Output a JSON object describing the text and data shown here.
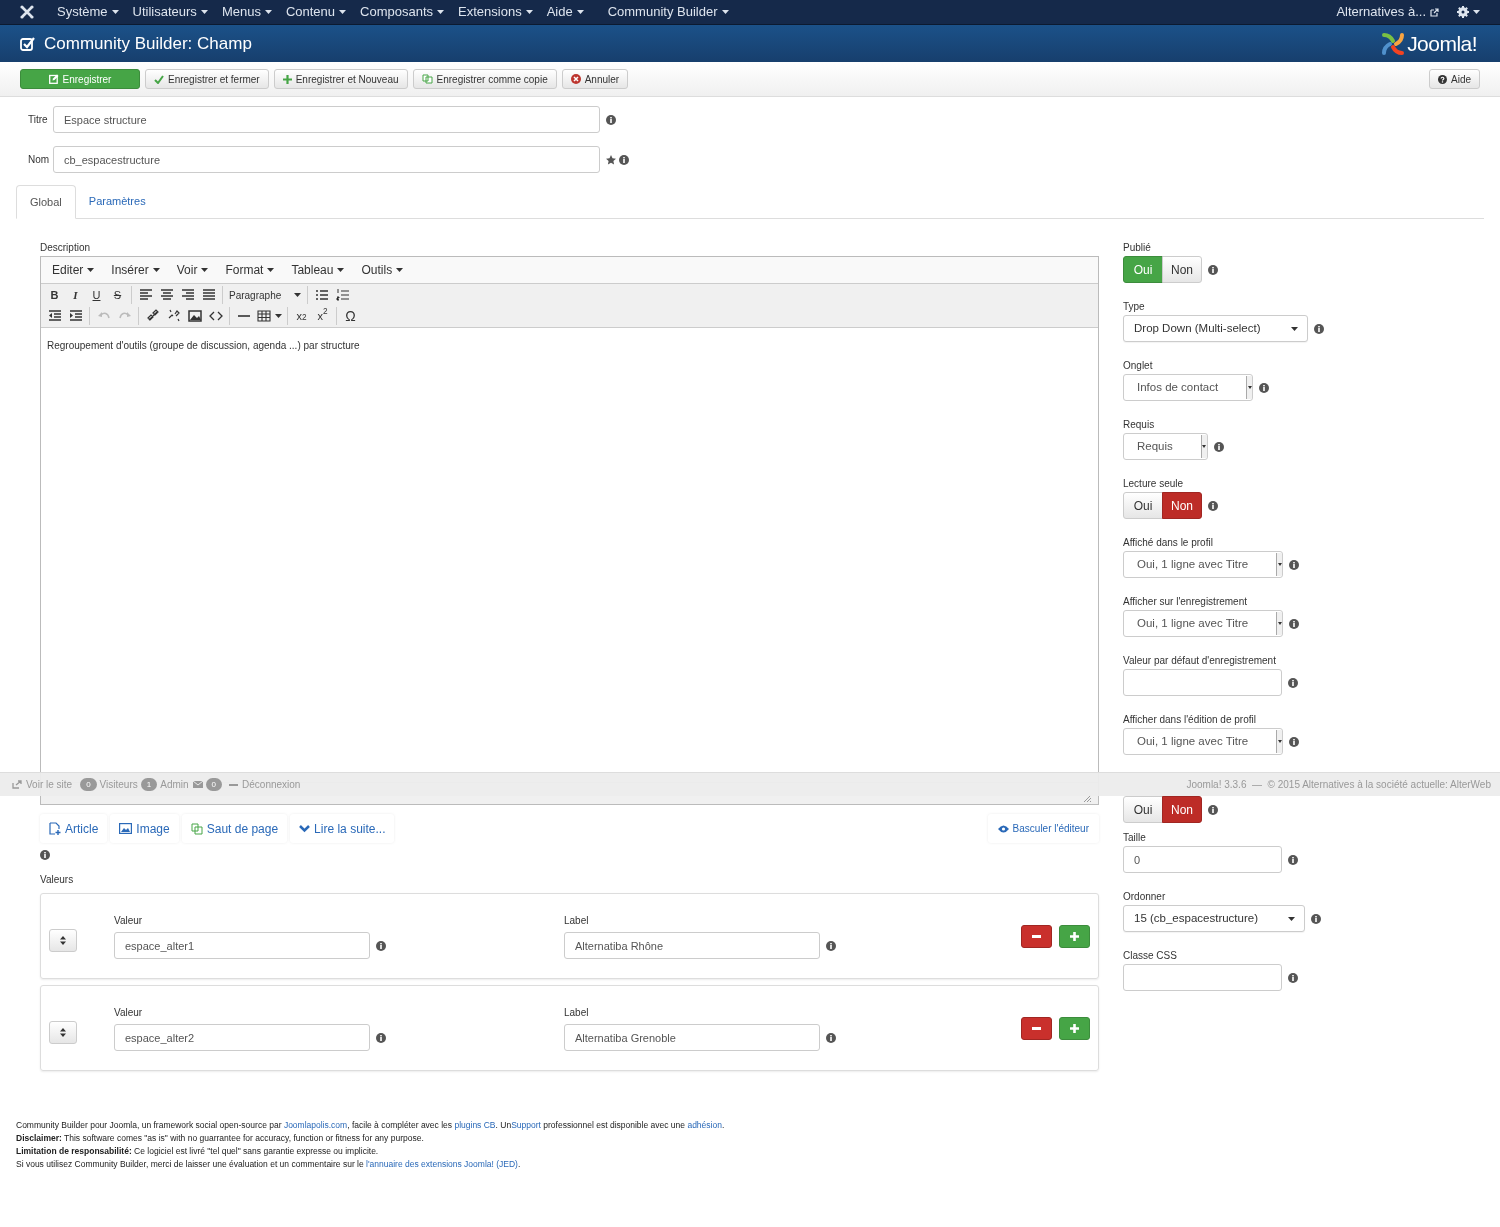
{
  "topbar": {
    "menus": [
      "Système",
      "Utilisateurs",
      "Menus",
      "Contenu",
      "Composants",
      "Extensions",
      "Aide",
      "Community Builder"
    ],
    "site_link": "Alternatives à..."
  },
  "header": {
    "title": "Community Builder: Champ",
    "logo": "Joomla!"
  },
  "toolbar": {
    "buttons": [
      {
        "kind": "save",
        "label": "Enregistrer"
      },
      {
        "kind": "check",
        "label": "Enregistrer et fermer"
      },
      {
        "kind": "plus",
        "label": "Enregistrer et Nouveau"
      },
      {
        "kind": "copy",
        "label": "Enregistrer comme copie"
      },
      {
        "kind": "cancel",
        "label": "Annuler"
      }
    ],
    "help": "Aide"
  },
  "fields": [
    {
      "label": "Titre",
      "value": "Espace structure",
      "required": false
    },
    {
      "label": "Nom",
      "value": "cb_espacestructure",
      "required": true
    }
  ],
  "tabs": [
    {
      "label": "Global",
      "selected": true
    },
    {
      "label": "Paramètres",
      "selected": false
    }
  ],
  "editor": {
    "label": "Description",
    "menus": [
      "Editer",
      "Insérer",
      "Voir",
      "Format",
      "Tableau",
      "Outils"
    ],
    "toolbar_rows": [
      [
        {
          "kind": "text",
          "label": "B",
          "disabled": false
        },
        {
          "kind": "text",
          "label": "I",
          "disabled": false
        },
        {
          "kind": "text",
          "label": "U",
          "disabled": false
        },
        {
          "kind": "text",
          "label": "S",
          "disabled": false
        },
        {
          "kind": "sep"
        },
        {
          "kind": "icon",
          "disabled": false
        },
        {
          "kind": "icon",
          "disabled": false
        },
        {
          "kind": "icon",
          "disabled": false
        },
        {
          "kind": "icon",
          "disabled": false
        },
        {
          "kind": "sep"
        },
        {
          "kind": "dropdown",
          "label": "Paragraphe",
          "disabled": false
        },
        {
          "kind": "sep"
        },
        {
          "kind": "icon",
          "disabled": false
        },
        {
          "kind": "icon",
          "disabled": false
        }
      ],
      [
        {
          "kind": "icon",
          "disabled": false
        },
        {
          "kind": "icon",
          "disabled": false
        },
        {
          "kind": "sep"
        },
        {
          "kind": "icon",
          "disabled": true
        },
        {
          "kind": "icon",
          "disabled": true
        },
        {
          "kind": "sep"
        },
        {
          "kind": "icon",
          "disabled": false
        },
        {
          "kind": "icon",
          "disabled": false
        },
        {
          "kind": "icon",
          "disabled": false
        },
        {
          "kind": "icon",
          "disabled": false
        },
        {
          "kind": "sep"
        },
        {
          "kind": "icon",
          "disabled": false
        },
        {
          "kind": "table",
          "disabled": false
        },
        {
          "kind": "sep"
        },
        {
          "kind": "text",
          "label": "x$_{2}$",
          "disabled": false
        },
        {
          "kind": "text",
          "label": "x$^{2}$",
          "disabled": false
        },
        {
          "kind": "sep"
        },
        {
          "kind": "text",
          "label": "Ω",
          "disabled": false
        }
      ]
    ],
    "content": "Regroupement d'outils (groupe de discussion, agenda ...) par structure",
    "buttons": [
      {
        "kind": "article",
        "label": "Article"
      },
      {
        "kind": "image",
        "label": "Image"
      },
      {
        "kind": "pagebreak",
        "label": "Saut de page"
      },
      {
        "kind": "readmore",
        "label": "Lire la suite..."
      }
    ],
    "toggle": "Basculer l'éditeur"
  },
  "values": {
    "label": "Valeurs",
    "rows": [
      {
        "value_label": "Valeur",
        "value": "espace_alter1",
        "label_label": "Label",
        "label": "Alternatiba Rhône"
      },
      {
        "value_label": "Valeur",
        "value": "espace_alter2",
        "label_label": "Label",
        "label": "Alternatiba Grenoble"
      }
    ]
  },
  "settings": [
    {
      "kind": "toggle",
      "label": "Publié",
      "options": [
        {
          "label": "Oui",
          "selected": true
        },
        {
          "label": "Non",
          "selected": false
        }
      ]
    },
    {
      "kind": "chosen",
      "label": "Type",
      "value": "Drop Down (Multi-select)"
    },
    {
      "kind": "select",
      "label": "Onglet",
      "value": "Infos de contact"
    },
    {
      "kind": "select",
      "label": "Requis",
      "value": "Requis"
    },
    {
      "kind": "toggle",
      "label": "Lecture seule",
      "options": [
        {
          "label": "Oui",
          "selected": false
        },
        {
          "label": "Non",
          "selected": true
        }
      ]
    },
    {
      "kind": "select",
      "label": "Affiché dans le profil",
      "value": "Oui, 1 ligne avec Titre"
    },
    {
      "kind": "select",
      "label": "Afficher sur l'enregistrement",
      "value": "Oui, 1 ligne avec Titre"
    },
    {
      "kind": "input",
      "label": "Valeur par défaut d'enregistrement"
    },
    {
      "kind": "select",
      "label": "Afficher dans l'édition de profil",
      "value": "Oui, 1 ligne avec Titre"
    },
    {
      "kind": "toggle",
      "options": [
        {
          "label": "Oui",
          "selected": false
        },
        {
          "label": "Non",
          "selected": true
        }
      ]
    },
    {
      "kind": "input",
      "label": "Taille",
      "value": "0"
    },
    {
      "kind": "chosen",
      "label": "Ordonner",
      "value": "15 (cb_espacestructure)"
    },
    {
      "kind": "input",
      "label": "Classe CSS"
    }
  ],
  "status_bar": {
    "site": "Voir le site",
    "visitors_count": "0",
    "visitors": "Visiteurs",
    "admin_count": "1",
    "admin": "Admin",
    "messages_count": "0",
    "logout": "Déconnexion",
    "credits": "Joomla! 3.3.6  —  © 2015 Alternatives à la société actuelle: AlterWeb"
  },
  "footer": [
    [
      {
        "kind": "text",
        "text": "Community Builder pour Joomla, un framework social open-source par "
      },
      {
        "kind": "link",
        "text": "Joomlapolis.com"
      },
      {
        "kind": "text",
        "text": ", facile à compléter avec les "
      },
      {
        "kind": "link",
        "text": "plugins CB"
      },
      {
        "kind": "text",
        "text": ". Un"
      },
      {
        "kind": "link",
        "text": "Support"
      },
      {
        "kind": "text",
        "text": " professionnel est disponible avec une "
      },
      {
        "kind": "link",
        "text": "adhésion"
      },
      {
        "kind": "text",
        "text": "."
      }
    ],
    [
      {
        "kind": "bold",
        "text": "Disclaimer:"
      },
      {
        "kind": "text",
        "text": " This software comes \"as is\" with no guarrantee for accuracy, function or fitness for any purpose."
      }
    ],
    [
      {
        "kind": "bold",
        "text": "Limitation de responsabilité:"
      },
      {
        "kind": "text",
        "text": " Ce logiciel est livré \"tel quel\" sans garantie expresse ou implicite."
      }
    ],
    [
      {
        "kind": "text",
        "text": "Si vous utilisez Community Builder, merci de laisser une évaluation et un commentaire sur le "
      },
      {
        "kind": "link",
        "text": "l'annuaire des extensions Joomla! (JED)"
      },
      {
        "kind": "text",
        "text": "."
      }
    ]
  ]
}
